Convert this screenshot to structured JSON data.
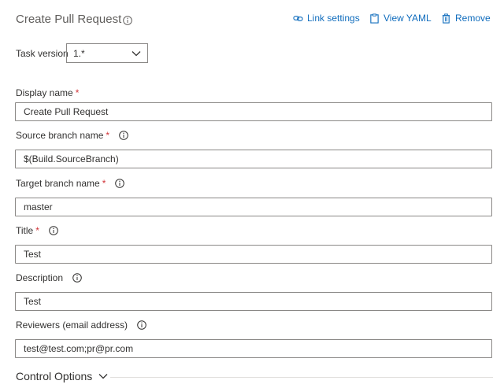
{
  "header": {
    "title": "Create Pull Request",
    "actions": [
      {
        "label": "Link settings",
        "icon": "link-icon"
      },
      {
        "label": "View YAML",
        "icon": "clipboard-icon"
      },
      {
        "label": "Remove",
        "icon": "trash-icon"
      }
    ]
  },
  "task_version": {
    "label": "Task version",
    "value": "1.*"
  },
  "fields": {
    "display_name": {
      "label": "Display name",
      "required": "*",
      "value": "Create Pull Request"
    },
    "source_branch": {
      "label": "Source branch name",
      "required": "*",
      "value": "$(Build.SourceBranch)"
    },
    "target_branch": {
      "label": "Target branch name",
      "required": "*",
      "value": "master"
    },
    "title": {
      "label": "Title",
      "required": "*",
      "value": "Test"
    },
    "description": {
      "label": "Description",
      "value": "Test"
    },
    "reviewers": {
      "label": "Reviewers (email address)",
      "value": "test@test.com;pr@pr.com"
    }
  },
  "control_options": {
    "label": "Control Options"
  },
  "colors": {
    "accent": "#0f6cbd",
    "required": "#d13438",
    "border": "#8a8886"
  }
}
